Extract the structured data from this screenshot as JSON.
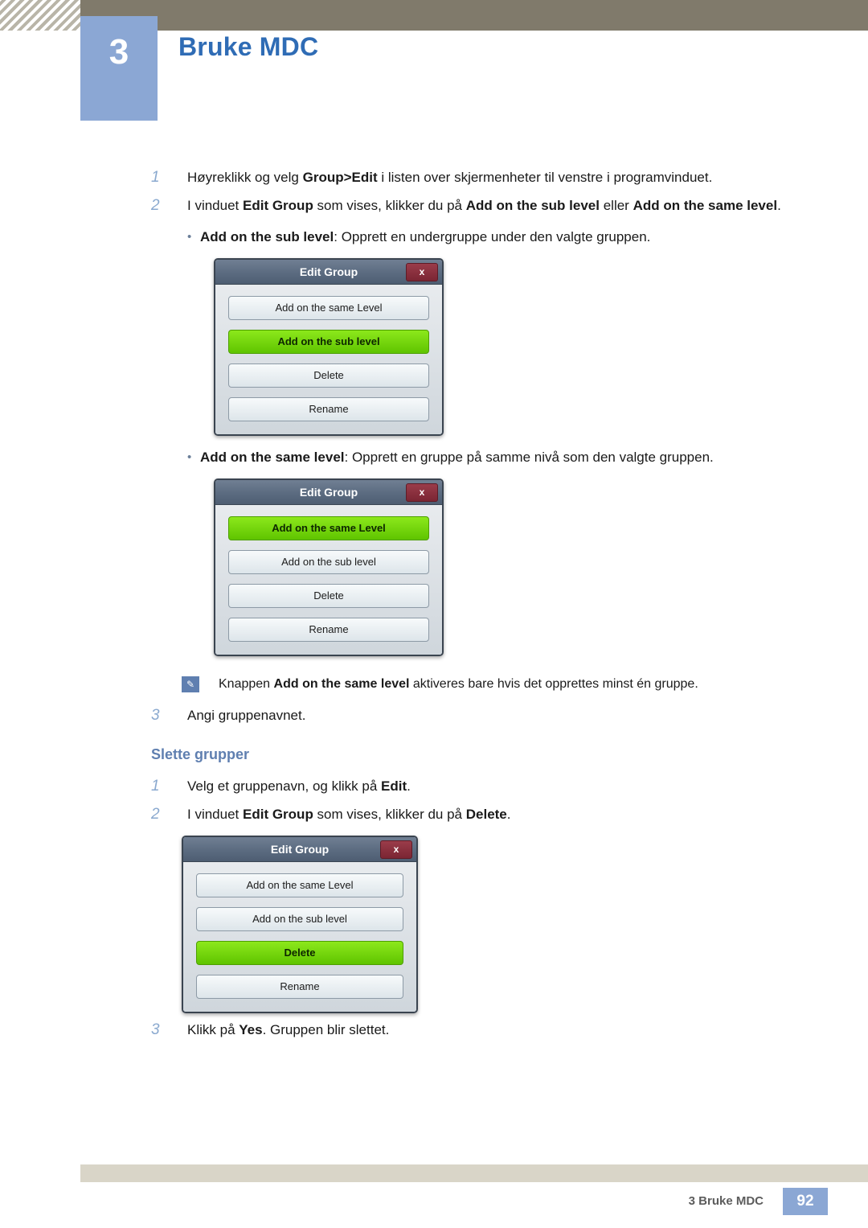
{
  "header": {
    "chapter_number": "3",
    "chapter_title": "Bruke MDC"
  },
  "steps_top": [
    {
      "num": "1",
      "parts": [
        {
          "t": "Høyreklikk og velg ",
          "b": false
        },
        {
          "t": "Group>Edit",
          "b": true
        },
        {
          "t": " i listen over skjermenheter til venstre i programvinduet.",
          "b": false
        }
      ]
    },
    {
      "num": "2",
      "parts": [
        {
          "t": "I vinduet ",
          "b": false
        },
        {
          "t": "Edit Group",
          "b": true
        },
        {
          "t": " som vises, klikker du på ",
          "b": false
        },
        {
          "t": "Add on the sub level",
          "b": true
        },
        {
          "t": " eller ",
          "b": false
        },
        {
          "t": "Add on the same level",
          "b": true
        },
        {
          "t": ".",
          "b": false
        }
      ]
    }
  ],
  "bullet_sub": {
    "dot": "•",
    "parts": [
      {
        "t": "Add on the sub level",
        "b": true
      },
      {
        "t": ": Opprett en undergruppe under den valgte gruppen.",
        "b": false
      }
    ]
  },
  "bullet_same": {
    "dot": "•",
    "parts": [
      {
        "t": "Add on the same level",
        "b": true
      },
      {
        "t": ": Opprett en gruppe på samme nivå som den valgte gruppen.",
        "b": false
      }
    ]
  },
  "dialog_sub": {
    "title": "Edit Group",
    "close_label": "x",
    "buttons": [
      {
        "label": "Add on the same Level",
        "active": false
      },
      {
        "label": "Add on the sub level",
        "active": true
      },
      {
        "label": "Delete",
        "active": false
      },
      {
        "label": "Rename",
        "active": false
      }
    ]
  },
  "dialog_same": {
    "title": "Edit Group",
    "close_label": "x",
    "buttons": [
      {
        "label": "Add on the same Level",
        "active": true
      },
      {
        "label": "Add on the sub level",
        "active": false
      },
      {
        "label": "Delete",
        "active": false
      },
      {
        "label": "Rename",
        "active": false
      }
    ]
  },
  "dialog_delete": {
    "title": "Edit Group",
    "close_label": "x",
    "buttons": [
      {
        "label": "Add on the same Level",
        "active": false
      },
      {
        "label": "Add on the sub level",
        "active": false
      },
      {
        "label": "Delete",
        "active": true
      },
      {
        "label": "Rename",
        "active": false
      }
    ]
  },
  "note": {
    "icon": "✎",
    "parts": [
      {
        "t": "Knappen ",
        "b": false
      },
      {
        "t": "Add on the same level",
        "b": true
      },
      {
        "t": " aktiveres bare hvis det opprettes minst én gruppe.",
        "b": false
      }
    ]
  },
  "step3_top": {
    "num": "3",
    "parts": [
      {
        "t": "Angi gruppenavnet.",
        "b": false
      }
    ]
  },
  "section_delete": {
    "title": "Slette grupper",
    "steps": [
      {
        "num": "1",
        "parts": [
          {
            "t": "Velg et gruppenavn, og klikk på ",
            "b": false
          },
          {
            "t": "Edit",
            "b": true
          },
          {
            "t": ".",
            "b": false
          }
        ]
      },
      {
        "num": "2",
        "parts": [
          {
            "t": "I vinduet ",
            "b": false
          },
          {
            "t": "Edit Group",
            "b": true
          },
          {
            "t": " som vises, klikker du på ",
            "b": false
          },
          {
            "t": "Delete",
            "b": true
          },
          {
            "t": ".",
            "b": false
          }
        ]
      }
    ],
    "step3": {
      "num": "3",
      "parts": [
        {
          "t": "Klikk på ",
          "b": false
        },
        {
          "t": "Yes",
          "b": true
        },
        {
          "t": ". Gruppen blir slettet.",
          "b": false
        }
      ]
    }
  },
  "footer": {
    "text": "3 Bruke MDC",
    "page": "92"
  },
  "colors": {
    "accent_blue": "#8ba7d4",
    "title_blue": "#2f6cb5",
    "header_strip": "#807a6b",
    "green_active": "#6fd800"
  }
}
